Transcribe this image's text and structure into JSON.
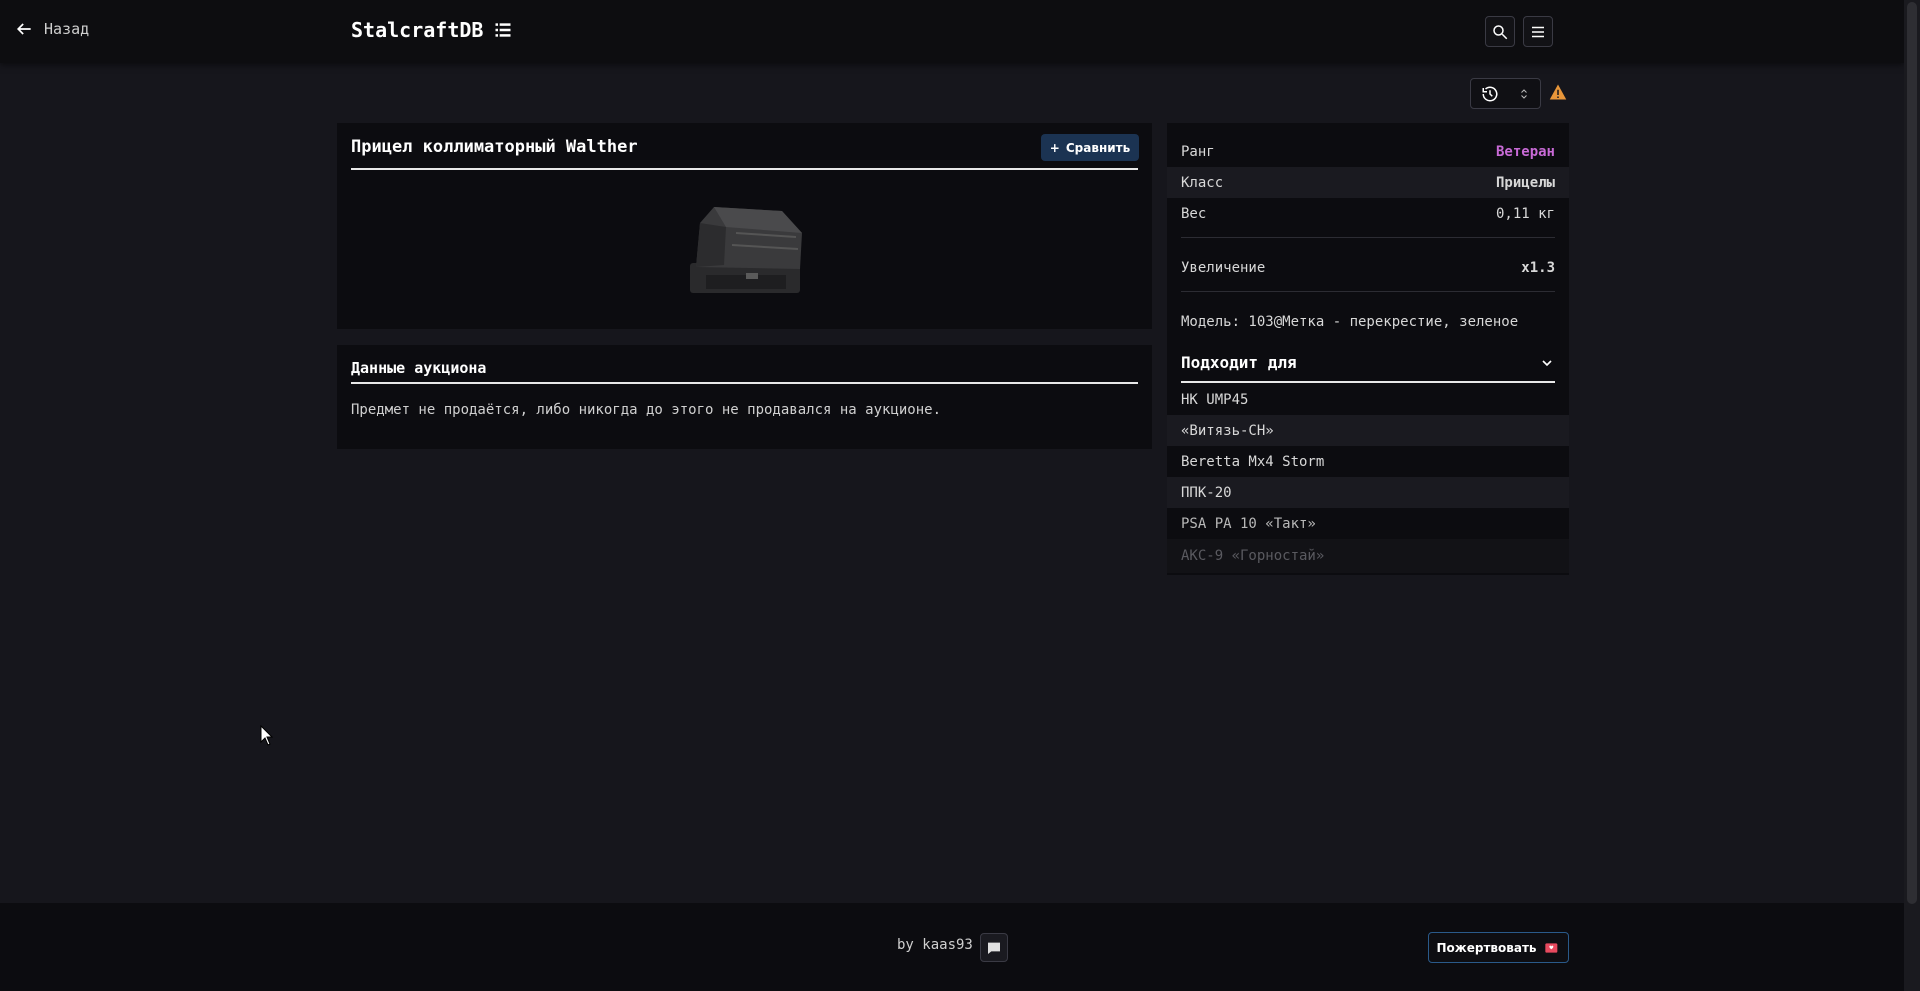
{
  "header": {
    "back_label": "Назад",
    "logo": "StalcraftDB"
  },
  "item": {
    "title": "Прицел коллиматорный Walther",
    "compare_label": "Сравнить"
  },
  "auction": {
    "title": "Данные аукциона",
    "message": "Предмет не продаётся, либо никогда до этого не продавался на аукционе."
  },
  "stats": {
    "rank_label": "Ранг",
    "rank_value": "Ветеран",
    "rank_color": "#c86ad6",
    "class_label": "Класс",
    "class_value": "Прицелы",
    "weight_label": "Вес",
    "weight_value": "0,11 кг",
    "zoom_label": "Увеличение",
    "zoom_value": "x1.3",
    "model_text": "Модель: 103@Метка - перекрестие, зеленое"
  },
  "fits": {
    "title": "Подходит для",
    "items": [
      "HK UMP45",
      "«Витязь-СН»",
      "Beretta Mx4 Storm",
      "ППК-20",
      "PSA PA 10 «Такт»",
      "АКС-9 «Горностай»"
    ]
  },
  "footer": {
    "by_text": "by kaas93",
    "donate_label": "Пожертвовать"
  },
  "colors": {
    "accent_button": "#1b3352",
    "warning": "#e8963a"
  }
}
